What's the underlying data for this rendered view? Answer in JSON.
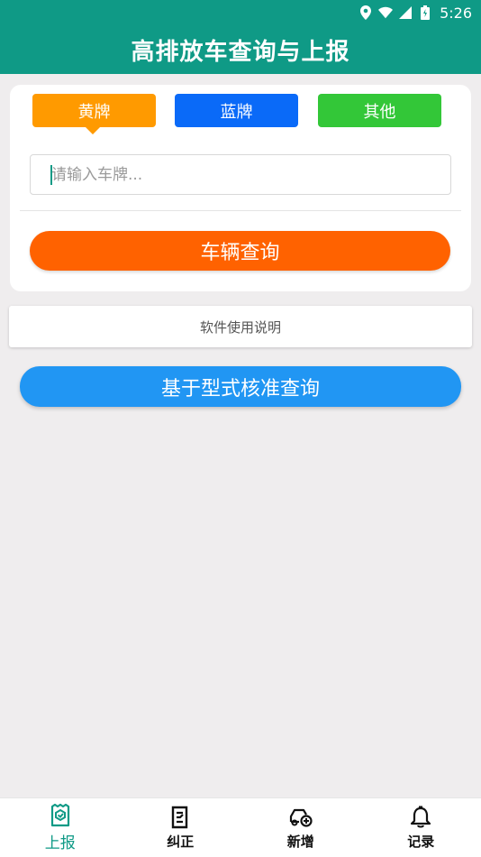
{
  "status_bar": {
    "time": "5:26",
    "icons": [
      "location-icon",
      "wifi-icon",
      "signal-icon",
      "battery-icon"
    ]
  },
  "app_bar": {
    "title": "高排放车查询与上报"
  },
  "plate_types": {
    "yellow": "黄牌",
    "blue": "蓝牌",
    "other": "其他",
    "selected": "黄牌"
  },
  "search": {
    "placeholder": "请输入车牌...",
    "value": ""
  },
  "buttons": {
    "vehicle_query": "车辆查询",
    "manual": "软件使用说明",
    "type_approval_query": "基于型式核准查询"
  },
  "bottom_nav": {
    "items": [
      {
        "label": "上报",
        "icon": "report-icon",
        "active": true
      },
      {
        "label": "纠正",
        "icon": "correct-icon",
        "active": false
      },
      {
        "label": "新增",
        "icon": "add-vehicle-icon",
        "active": false
      },
      {
        "label": "记录",
        "icon": "bell-icon",
        "active": false
      }
    ]
  },
  "colors": {
    "primary": "#0f9a86",
    "yellow_plate": "#ff9a00",
    "blue_plate": "#0a6af8",
    "other_plate": "#33c738",
    "query_button": "#ff6200",
    "type_button": "#2196f3",
    "background": "#efedee"
  }
}
